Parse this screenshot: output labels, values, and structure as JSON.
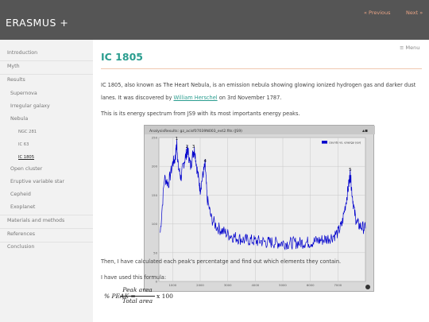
{
  "header": {
    "site_title": "ERASMUS +",
    "prev_label": "« Previous",
    "next_label": "Next »"
  },
  "sidebar": {
    "items": [
      {
        "label": "Introduction"
      },
      {
        "label": "Myth"
      },
      {
        "label": "Results"
      },
      {
        "label": "Supernova"
      },
      {
        "label": "Irregular galaxy"
      },
      {
        "label": "Nebula"
      },
      {
        "label": "NGC 281"
      },
      {
        "label": "IC 63"
      },
      {
        "label": "IC 1805",
        "active": true
      },
      {
        "label": "Open cluster"
      },
      {
        "label": "Eruptive variable star"
      },
      {
        "label": "Cepheid"
      },
      {
        "label": "Exoplanet"
      },
      {
        "label": "Materials and methods"
      },
      {
        "label": "References"
      },
      {
        "label": "Conclusion"
      }
    ]
  },
  "main": {
    "menu_label": "≡ Menu",
    "title": "IC 1805",
    "intro_1": "IC 1805, also known as The Heart Nebula, is an emission nebula showing glowing ionized hydrogen gas and darker dust lanes. It was discovered by ",
    "intro_link": "William Herschel",
    "intro_2": " on 3rd November 1787.",
    "spectrum_intro": "This is its energy spectrum from JS9 with its most importants energy peaks.",
    "calc_text": "Then, I have calculated each peak's percentatge and find out which elements they contain.",
    "formula_intro": "I have used this formula:",
    "formula_lhs": "% PEAK =",
    "formula_num": "Peak area",
    "formula_den": "Total area",
    "formula_tail": "x 100"
  },
  "chart_data": {
    "type": "line",
    "window_title": "AnalysisResults: gz_acisf07039N003_evt2.fits (JS9)",
    "legend": "counts vs. energy (ev)",
    "series_color": "#0000cc",
    "xticks": [
      1000,
      2000,
      3000,
      4000,
      5000,
      6000,
      7000
    ],
    "yticks": [
      0,
      50,
      100,
      150,
      200,
      250
    ],
    "xlim": [
      500,
      8000
    ],
    "ylim": [
      0,
      250
    ],
    "peaks": [
      {
        "label": "1",
        "x": 1150,
        "y": 242
      },
      {
        "label": "2",
        "x": 1520,
        "y": 228
      },
      {
        "label": "3",
        "x": 1760,
        "y": 228
      },
      {
        "label": "4",
        "x": 2180,
        "y": 203
      },
      {
        "label": "5",
        "x": 7450,
        "y": 188
      }
    ],
    "x": [
      550,
      700,
      850,
      1000,
      1100,
      1150,
      1200,
      1300,
      1400,
      1500,
      1550,
      1650,
      1750,
      1800,
      1900,
      2000,
      2100,
      2180,
      2250,
      2400,
      2600,
      2800,
      3000,
      3200,
      3400,
      3600,
      3800,
      4000,
      4200,
      4400,
      4600,
      4800,
      5000,
      5200,
      5400,
      5600,
      5800,
      6000,
      6200,
      6400,
      6600,
      6800,
      7000,
      7150,
      7300,
      7400,
      7450,
      7500,
      7600,
      7700,
      7850,
      8000
    ],
    "y": [
      85,
      180,
      170,
      205,
      215,
      242,
      200,
      180,
      205,
      222,
      228,
      200,
      225,
      228,
      190,
      160,
      185,
      203,
      145,
      110,
      95,
      88,
      82,
      78,
      75,
      72,
      72,
      70,
      70,
      68,
      68,
      67,
      67,
      66,
      67,
      67,
      68,
      68,
      70,
      72,
      74,
      78,
      85,
      100,
      140,
      170,
      188,
      160,
      120,
      100,
      95,
      92
    ]
  }
}
